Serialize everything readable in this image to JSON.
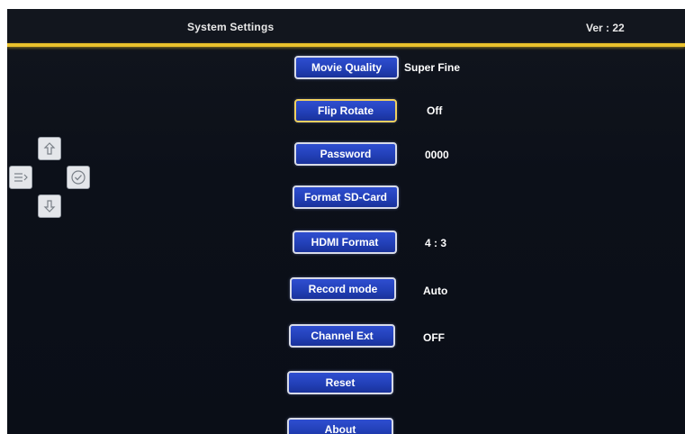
{
  "header": {
    "title": "System Settings",
    "version": "Ver : 22"
  },
  "menu": {
    "items": [
      {
        "label": "Movie Quality",
        "value": "Super Fine"
      },
      {
        "label": "Flip Rotate",
        "value": "Off"
      },
      {
        "label": "Password",
        "value": "0000"
      },
      {
        "label": "Format SD-Card",
        "value": ""
      },
      {
        "label": "HDMI Format",
        "value": "4 : 3"
      },
      {
        "label": "Record mode",
        "value": "Auto"
      },
      {
        "label": "Channel Ext",
        "value": "OFF"
      },
      {
        "label": "Reset",
        "value": ""
      },
      {
        "label": "About",
        "value": ""
      }
    ],
    "selected": "Flip Rotate"
  },
  "navpad": {
    "icons": [
      "up-arrow-icon",
      "menu-list-icon",
      "check-icon",
      "down-arrow-icon"
    ]
  },
  "colors": {
    "accent_line": "#e9c12c",
    "button_fill": "#2240b8",
    "button_border": "#d8dbe8",
    "background": "#0c1019"
  }
}
